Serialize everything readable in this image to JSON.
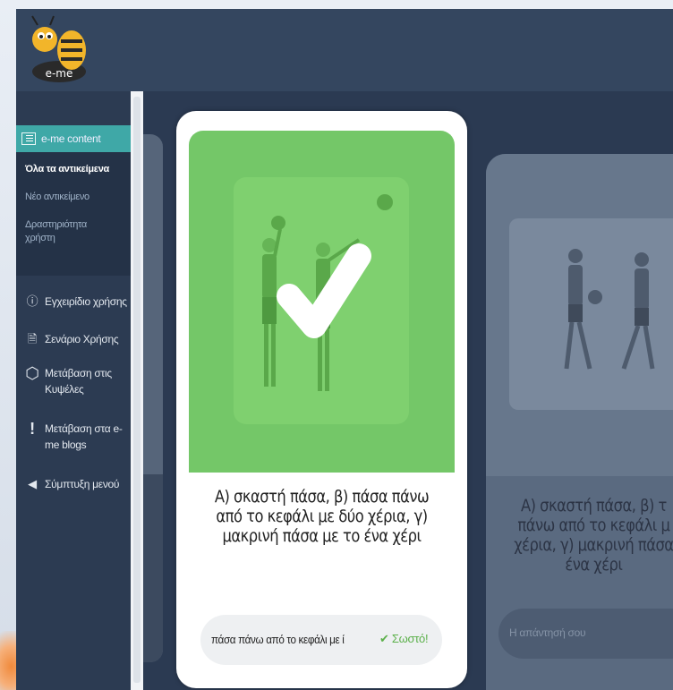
{
  "logo": {
    "text": "e-me"
  },
  "sidebar": {
    "header": {
      "label": "e-me content",
      "icon": "content-list-icon"
    },
    "sub_items": [
      {
        "label": "Όλα τα αντικείμενα",
        "active": true
      },
      {
        "label": "Νέο αντικείμενο",
        "active": false
      },
      {
        "label_line1": "Δραστηριότητα",
        "label_line2": "χρήστη",
        "active": false
      }
    ],
    "items": [
      {
        "label": "Εγχειρίδιο χρήσης",
        "icon": "info-circle-icon"
      },
      {
        "label": "Σενάριο Χρήσης",
        "icon": "document-icon"
      },
      {
        "label_line1": "Μετάβαση στις",
        "label_line2": "Κυψέλες",
        "icon": "hexagon-icon"
      },
      {
        "label_line1": "Μετάβαση στα e-",
        "label_line2": "me blogs",
        "icon": "exclamation-icon"
      },
      {
        "label": "Σύμπτυξη μενού",
        "icon": "collapse-arrow-icon"
      }
    ]
  },
  "main_card": {
    "question": "Α) σκαστή πάσα, β) πάσα πάνω από το κεφάλι με δύο χέρια, γ) μακρινή πάσα με το ένα χέρι",
    "answer": "πάσα πάνω από το κεφάλι με ί",
    "result": "✔ Σωστό!",
    "result_color": "#5bb04a",
    "image_bg": "#74c768"
  },
  "next_card": {
    "question_line1": "Α) σκαστή πάσα, β) τ",
    "question_line2": "πάνω από το κεφάλι μ",
    "question_line3": "χέρια, γ) μακρινή πάσα",
    "question_line4": "ένα χέρι",
    "input_placeholder": "Η απάντησή σου"
  },
  "colors": {
    "accent": "#3fa8a7",
    "topbar": "#34465f",
    "sidebar": "#2c3b52"
  }
}
